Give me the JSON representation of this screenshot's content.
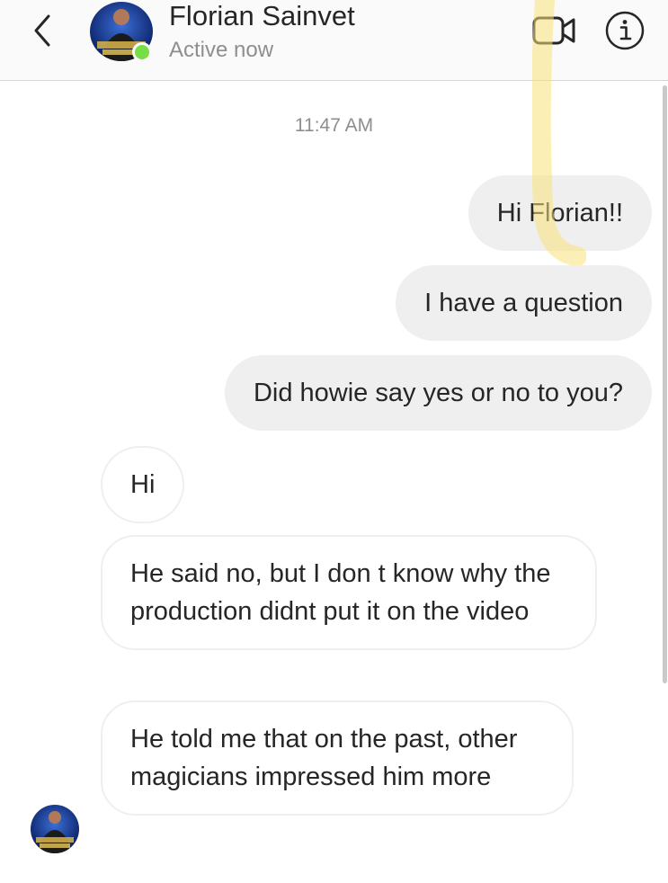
{
  "header": {
    "contact_name": "Florian Sainvet",
    "status": "Active now",
    "back_icon": "chevron-left-icon",
    "video_icon": "video-camera-icon",
    "info_icon": "info-icon"
  },
  "thread": {
    "timestamp": "11:47 AM",
    "outgoing": [
      "Hi Florian!!",
      "I have a question",
      "Did howie say yes or no to you?"
    ],
    "incoming": [
      "Hi",
      "He said no, but I don t know why the production didnt put it on the video",
      "He told me that on the past, other magicians impressed him more"
    ]
  },
  "colors": {
    "online": "#78de45",
    "outgoing_bubble": "#efefef",
    "incoming_border": "#efefef",
    "secondary_text": "#8e8e8e",
    "highlight": "#f7e27a"
  }
}
